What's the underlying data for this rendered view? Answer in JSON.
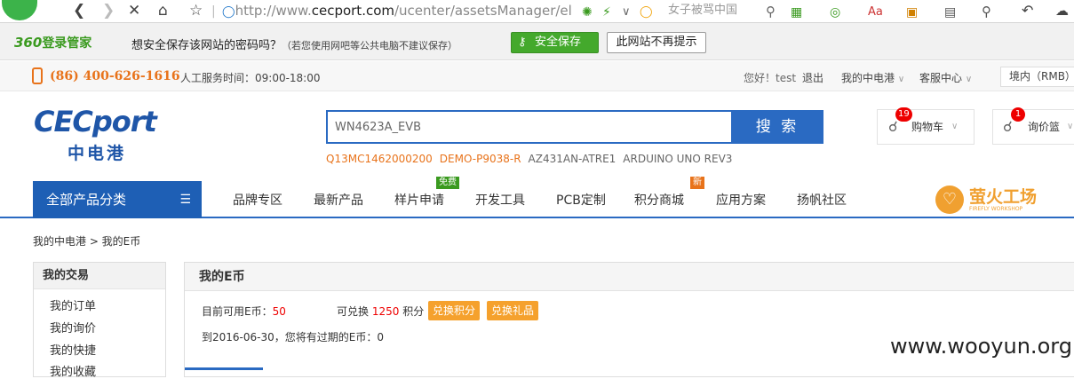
{
  "browser": {
    "url_prefix": "http://www.",
    "url_domain": "cecport.com",
    "url_rest": "/ucenter/assetsManager/el",
    "search_text": "女子被骂中国"
  },
  "password_bar": {
    "brand_num": "360",
    "brand_text": "登录管家",
    "message": "想安全保存该网站的密码吗？",
    "note": "（若您使用网吧等公共电脑不建议保存）",
    "save_label": "安全保存",
    "never_label": "此网站不再提示"
  },
  "topbar": {
    "phone": "(86) 400-626-1616",
    "service_hours": "人工服务时间：09:00-18:00",
    "greeting": "您好！test",
    "logout": "退出",
    "my_cecport": "我的中电港",
    "service_center": "客服中心",
    "region": "境内（RMB）"
  },
  "header": {
    "logo_en": "CECport",
    "logo_cn": "中电港",
    "search_value": "WN4623A_EVB",
    "search_button": "搜 索",
    "hot_words": [
      {
        "text": "Q13MC1462000200",
        "color": "#e8731b"
      },
      {
        "text": "DEMO-P9038-R",
        "color": "#e8731b"
      },
      {
        "text": "AZ431AN-ATRE1",
        "color": "#666666"
      },
      {
        "text": "ARDUINO UNO REV3",
        "color": "#666666"
      }
    ],
    "cart_label": "购物车",
    "cart_count": "19",
    "inquiry_label": "询价篮",
    "inquiry_count": "1"
  },
  "nav": {
    "all_categories": "全部产品分类",
    "items": [
      "品牌专区",
      "最新产品",
      "样片申请",
      "开发工具",
      "PCB定制",
      "积分商城",
      "应用方案",
      "扬帆社区"
    ],
    "tag_free": "免费",
    "tag_new": "新",
    "firefly_cn": "萤火工场",
    "firefly_en": "FIREFLY WORKSHOP"
  },
  "breadcrumb": "我的中电港 > 我的E币",
  "sidebar": {
    "title": "我的交易",
    "items": [
      "我的订单",
      "我的询价",
      "我的快捷",
      "我的收藏"
    ]
  },
  "main": {
    "title": "我的E币",
    "available_label": "目前可用E币：",
    "available_value": "50",
    "exchange_label": "可兑换",
    "exchange_value": "1250",
    "exchange_unit": "积分",
    "exchange_points_btn": "兑换积分",
    "exchange_gift_btn": "兑换礼品",
    "expiry_text": "到2016-06-30，您将有过期的E币：0"
  },
  "watermark": "www.wooyun.org",
  "colors": {
    "brand_blue": "#1e5fb5",
    "orange": "#e8731b",
    "green": "#44a92c",
    "red": "#e00000"
  }
}
